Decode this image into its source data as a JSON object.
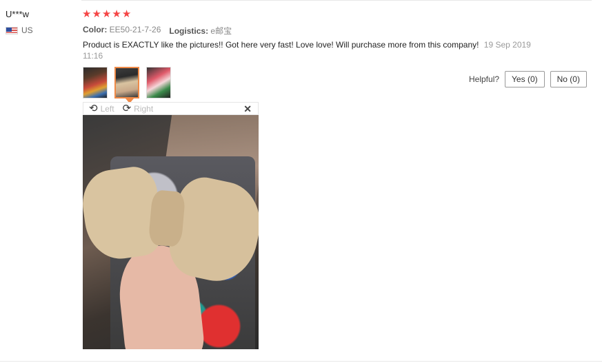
{
  "review": {
    "user_name": "U***w",
    "country": "US",
    "rating": 5,
    "stars": [
      "★",
      "★",
      "★",
      "★",
      "★"
    ],
    "color_label": "Color:",
    "color_value": "EE50-21-7-26",
    "logistics_label": "Logistics:",
    "logistics_value": "e邮宝",
    "text": "Product is EXACTLY like the pictures!! Got here very fast! Love love! Will purchase more from this company!",
    "date": "19 Sep 2019 11:16",
    "accent_color": "#f54545",
    "active_thumb_color": "#f08a47"
  },
  "helpful": {
    "label": "Helpful?",
    "yes_label": "Yes (0)",
    "no_label": "No (0)"
  },
  "viewer": {
    "rotate_left_icon": "rotate-left-icon",
    "left_label": "Left",
    "rotate_right_icon": "rotate-right-icon",
    "right_label": "Right",
    "close_icon": "close-icon",
    "close_glyph": "✕"
  }
}
